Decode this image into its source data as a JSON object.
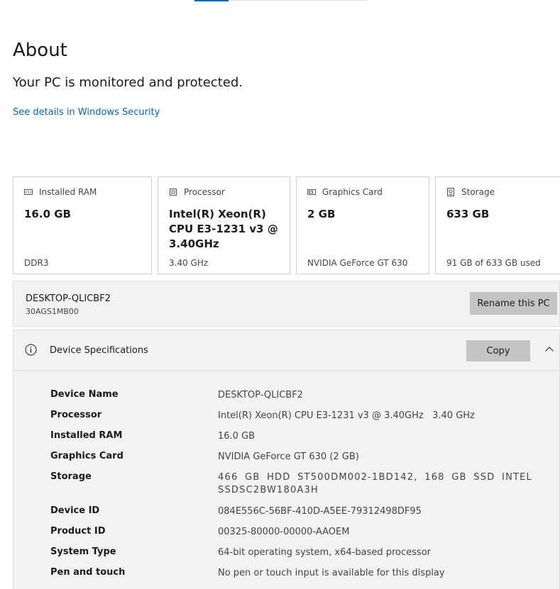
{
  "about": {
    "title": "About",
    "status": "Your PC is monitored and protected.",
    "security_link": "See details in Windows Security"
  },
  "cards": [
    {
      "icon": "ram-icon",
      "label": "Installed RAM",
      "value": "16.0 GB",
      "detail": "DDR3"
    },
    {
      "icon": "processor-icon",
      "label": "Processor",
      "value": "Intel(R) Xeon(R) CPU E3-1231 v3 @ 3.40GHz",
      "detail": "3.40 GHz"
    },
    {
      "icon": "graphics-card-icon",
      "label": "Graphics Card",
      "value": "2 GB",
      "detail": "NVIDIA GeForce GT 630"
    },
    {
      "icon": "storage-icon",
      "label": "Storage",
      "value": "633 GB",
      "detail": "91 GB of 633 GB used"
    }
  ],
  "pc": {
    "name": "DESKTOP-QLICBF2",
    "model": "30AGS1MB00",
    "rename_label": "Rename this PC"
  },
  "specs": {
    "title": "Device Specifications",
    "copy_label": "Copy",
    "rows": [
      {
        "label": "Device Name",
        "value": "DESKTOP-QLICBF2"
      },
      {
        "label": "Processor",
        "value": "Intel(R) Xeon(R) CPU E3-1231 v3 @ 3.40GHz   3.40 GHz"
      },
      {
        "label": "Installed RAM",
        "value": "16.0 GB"
      },
      {
        "label": "Graphics Card",
        "value": "NVIDIA GeForce GT 630 (2 GB)"
      },
      {
        "label": "Storage",
        "value": "466 GB HDD ST500DM002-1BD142, 168 GB SSD INTEL SSDSC2BW180A3H"
      },
      {
        "label": "Device ID",
        "value": "084E556C-56BF-410D-A5EE-79312498DF95"
      },
      {
        "label": "Product ID",
        "value": "00325-80000-00000-AAOEM"
      },
      {
        "label": "System Type",
        "value": "64-bit operating system, x64-based processor"
      },
      {
        "label": "Pen and touch",
        "value": "No pen or touch input is available for this display"
      }
    ]
  },
  "colors": {
    "accent": "#0067c0",
    "panel_bg": "#f2f2f2",
    "button_bg": "#c4c4c4"
  }
}
